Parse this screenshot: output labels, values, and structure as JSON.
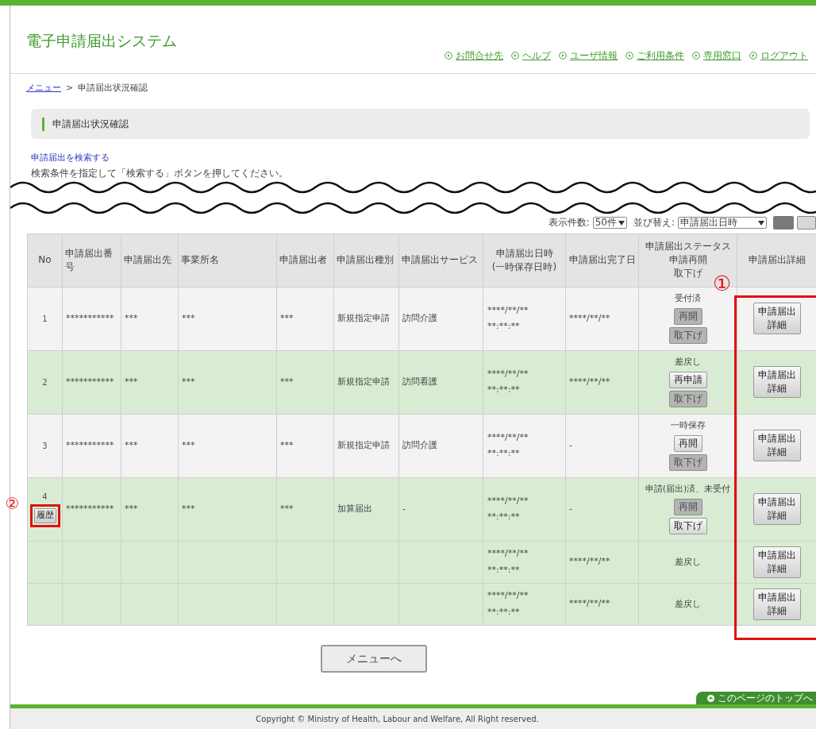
{
  "header": {
    "title": "電子申請届出システム",
    "links": [
      "お問合せ先",
      "ヘルプ",
      "ユーザ情報",
      "ご利用条件",
      "専用窓口",
      "ログアウト"
    ]
  },
  "breadcrumb": {
    "link": "メニュー",
    "separator": ">",
    "current": "申請届出状況確認"
  },
  "page_title": "申請届出状況確認",
  "search": {
    "link": "申請届出を検索する",
    "instructions": "検索条件を指定して「検索する」ボタンを押してください。"
  },
  "list_controls": {
    "count_label": "表示件数:",
    "count_value": "50件",
    "sort_label": "並び替え:",
    "sort_value": "申請届出日時"
  },
  "table": {
    "columns": [
      [
        "No"
      ],
      [
        "申請届出番号"
      ],
      [
        "申請届出先"
      ],
      [
        "事業所名"
      ],
      [
        "申請届出者"
      ],
      [
        "申請届出種別"
      ],
      [
        "申請届出サービス"
      ],
      [
        "申請届出日時",
        "(一時保存日時)"
      ],
      [
        "申請届出完了日"
      ],
      [
        "申請届出ステータス",
        "申請再開",
        "取下げ"
      ],
      [
        "申請届出詳細"
      ]
    ],
    "rows": [
      {
        "tinted": false,
        "no": "1",
        "number": "***********",
        "destination": "***",
        "office": "***",
        "applicant": "***",
        "type": "新規指定申請",
        "service": "訪問介護",
        "datetime": [
          "****/**/**",
          "**:**:**"
        ],
        "completed": "****/**/**",
        "status": "受付済",
        "actions": [
          {
            "label": "再開",
            "disabled": true
          },
          {
            "label": "取下げ",
            "disabled": true
          }
        ],
        "detail": "申請届出詳細"
      },
      {
        "tinted": true,
        "no": "2",
        "number": "***********",
        "destination": "***",
        "office": "***",
        "applicant": "***",
        "type": "新規指定申請",
        "service": "訪問看護",
        "datetime": [
          "****/**/**",
          "**:**:**"
        ],
        "completed": "****/**/**",
        "status": "差戻し",
        "actions": [
          {
            "label": "再申請",
            "disabled": false
          },
          {
            "label": "取下げ",
            "disabled": true
          }
        ],
        "detail": "申請届出詳細"
      },
      {
        "tinted": false,
        "no": "3",
        "number": "***********",
        "destination": "***",
        "office": "***",
        "applicant": "***",
        "type": "新規指定申請",
        "service": "訪問介護",
        "datetime": [
          "****/**/**",
          "**:**:**"
        ],
        "completed": "-",
        "status": "一時保存",
        "actions": [
          {
            "label": "再開",
            "disabled": false
          },
          {
            "label": "取下げ",
            "disabled": true
          }
        ],
        "detail": "申請届出詳細"
      },
      {
        "tinted": true,
        "no": "4",
        "history": "履歴",
        "number": "***********",
        "destination": "***",
        "office": "***",
        "applicant": "***",
        "type": "加算届出",
        "service": "-",
        "datetime": [
          "****/**/**",
          "**:**:**"
        ],
        "completed": "-",
        "status": "申請(届出)済、未受付",
        "actions": [
          {
            "label": "再開",
            "disabled": true
          },
          {
            "label": "取下げ",
            "disabled": false
          }
        ],
        "detail": "申請届出詳細"
      },
      {
        "tinted": true,
        "datetime": [
          "****/**/**",
          "**:**:**"
        ],
        "completed": "****/**/**",
        "status": "差戻し",
        "detail": "申請届出詳細"
      },
      {
        "tinted": true,
        "datetime": [
          "****/**/**",
          "**:**:**"
        ],
        "completed": "****/**/**",
        "status": "差戻し",
        "detail": "申請届出詳細"
      }
    ]
  },
  "menu_button": "メニューへ",
  "page_top_link": "このページのトップへ",
  "copyright": "Copyright © Ministry of Health, Labour and Welfare, All Right reserved.",
  "annotations": [
    "①",
    "②"
  ]
}
